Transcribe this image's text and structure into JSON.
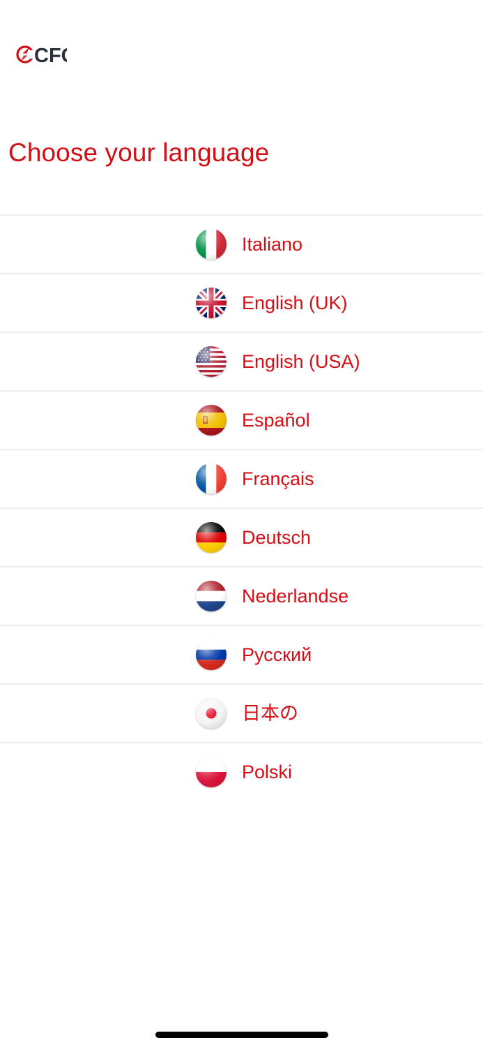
{
  "header": {
    "logo_text": "CFC",
    "title": "Choose your language"
  },
  "languages": [
    {
      "label": "Italiano",
      "flag": "italy-flag-icon"
    },
    {
      "label": "English (UK)",
      "flag": "uk-flag-icon"
    },
    {
      "label": "English (USA)",
      "flag": "usa-flag-icon"
    },
    {
      "label": "Español",
      "flag": "spain-flag-icon"
    },
    {
      "label": "Français",
      "flag": "france-flag-icon"
    },
    {
      "label": "Deutsch",
      "flag": "germany-flag-icon"
    },
    {
      "label": "Nederlandse",
      "flag": "netherlands-flag-icon"
    },
    {
      "label": "Русский",
      "flag": "russia-flag-icon"
    },
    {
      "label": "日本の",
      "flag": "japan-flag-icon"
    },
    {
      "label": "Polski",
      "flag": "poland-flag-icon"
    }
  ],
  "colors": {
    "accent": "#d40e14",
    "logo_dark": "#2b2f3a",
    "divider": "#ececec"
  }
}
